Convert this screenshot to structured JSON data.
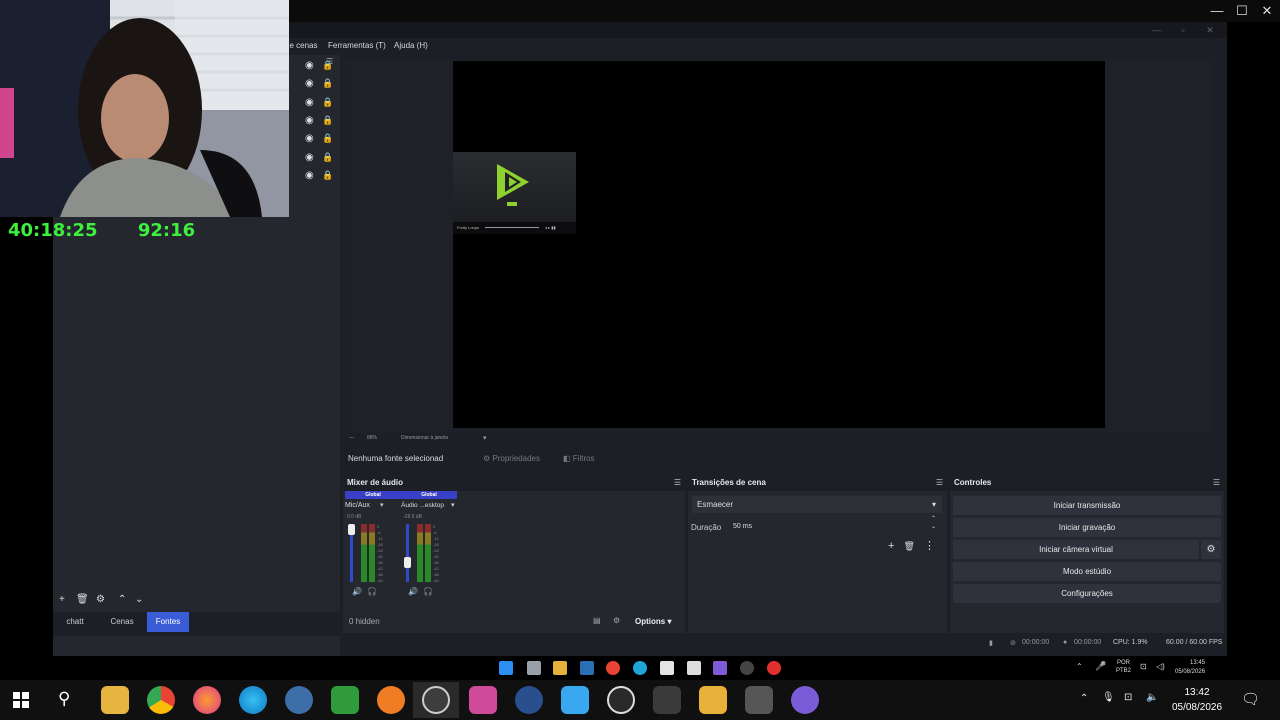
{
  "host_window": {
    "controls": [
      "—",
      "☐",
      "✕"
    ]
  },
  "obs": {
    "menu": [
      "de cenas",
      "Ferramentas (T)",
      "Ajuda (H)"
    ],
    "sources_rows": 7,
    "dock_tabs": [
      {
        "label": "chatt",
        "active": false
      },
      {
        "label": "Cenas",
        "active": false
      },
      {
        "label": "Fontes",
        "active": true
      }
    ],
    "zoom_text": "Dimensionar à janela",
    "zoom_pct": "88%",
    "no_source": "Nenhuma fonte selecionad",
    "props_btn": "Propriedades",
    "filters_btn": "Filtros",
    "player_title": "Fruity Loops",
    "mixer": {
      "title": "Mixer de áudio",
      "channels": [
        {
          "scope": "Global",
          "name": "Mic/Aux",
          "db": "0.0 dB"
        },
        {
          "scope": "Global",
          "name": "Áudio ...esktop",
          "db": "-28.6 dB"
        }
      ],
      "hidden": "0 hidden",
      "options": "Options"
    },
    "transitions": {
      "title": "Transições de cena",
      "selected": "Esmaecer",
      "duration_label": "Duração",
      "duration": "50 ms"
    },
    "controls": {
      "title": "Controles",
      "buttons": [
        "Iniciar transmissão",
        "Iniciar gravação",
        "Iniciar câmera virtual",
        "Modo estúdio",
        "Configurações"
      ]
    },
    "status": {
      "stream_time": "00:00:00",
      "rec_time": "00:00:00",
      "cpu": "CPU: 1.9%",
      "fps": "60.00 / 60.00 FPS"
    }
  },
  "overlay": {
    "timer_left": "40:18:25",
    "timer_right": "92:16"
  },
  "inner_tray": {
    "lang": "POR",
    "layout": "PTB2",
    "time": "13:45",
    "date": "05/08/2026"
  },
  "taskbar": {
    "time": "13:42",
    "date": "05/08/2026"
  },
  "colors": {
    "accent": "#3a5cd6",
    "timer": "#3ef03e",
    "obs_bg": "#1d1f26"
  }
}
